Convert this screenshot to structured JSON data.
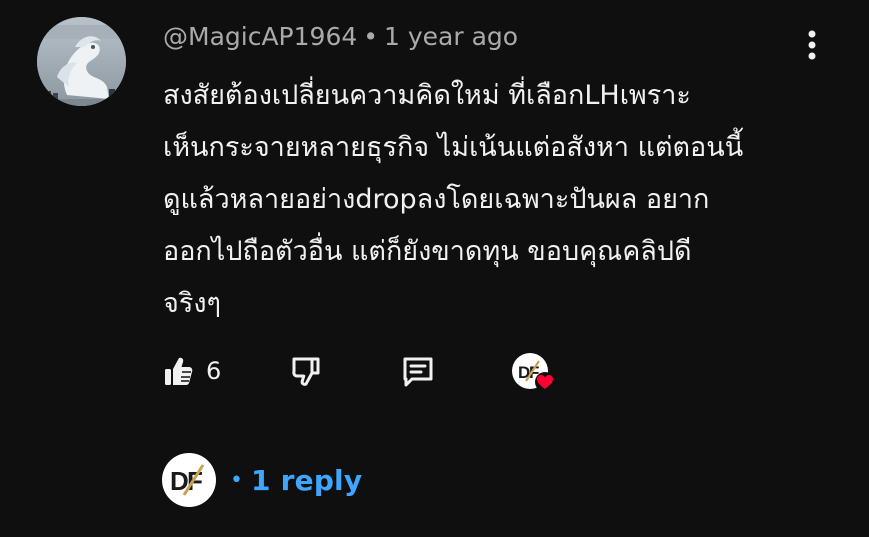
{
  "comment": {
    "author": "@MagicAP1964",
    "separator": "•",
    "time": "1 year ago",
    "lines": [
      "สงสัยต้องเปลี่ยนความคิดใหม่  ที่เลือกLHเพราะ",
      "เห็นกระจายหลายธุรกิจ ไม่เน้นแต่อสังหา แต่ตอนนี้",
      "ดูแล้วหลายอย่างdropลงโดยเฉพาะปันผล อยาก",
      "ออกไปถือตัวอื่น แต่ก็ยังขาดทุน ขอบคุณคลิปดี",
      "จริงๆ"
    ]
  },
  "actions": {
    "like_count": "6",
    "like_icon": "thumbs-up-icon",
    "dislike_icon": "thumbs-down-icon",
    "reply_icon": "comment-icon",
    "creator_heart_icon": "creator-heart-icon"
  },
  "replies": {
    "dot": "•",
    "label": "1 reply"
  },
  "colors": {
    "background": "#0f0f0f",
    "text": "#f1f1f1",
    "meta": "#aaaaaa",
    "link": "#3ea6ff",
    "heart": "#ff0033"
  }
}
